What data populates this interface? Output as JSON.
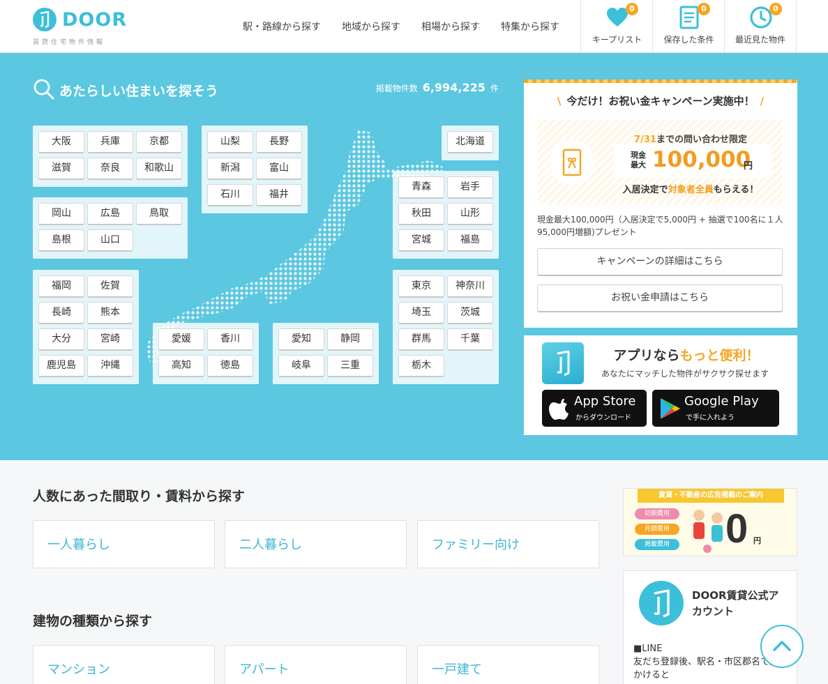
{
  "header": {
    "logo": {
      "text": "DOOR",
      "sub": "賃貸住宅物件情報"
    },
    "nav": [
      "駅・路線から探す",
      "地域から探す",
      "相場から探す",
      "特集から探す"
    ],
    "boxes": [
      {
        "label": "キープリスト",
        "badge": "0",
        "icon": "heart-icon"
      },
      {
        "label": "保存した条件",
        "badge": "0",
        "icon": "document-icon"
      },
      {
        "label": "最近見た物件",
        "badge": "0",
        "icon": "clock-icon"
      }
    ]
  },
  "hero": {
    "title": "あたらしい住まいを探そう",
    "count_label": "掲載物件数",
    "count_value": "6,994,225",
    "count_unit": "件",
    "regions": {
      "kinki": [
        "大阪",
        "兵庫",
        "京都",
        "滋賀",
        "奈良",
        "和歌山"
      ],
      "chugoku": [
        "岡山",
        "広島",
        "鳥取",
        "島根",
        "山口"
      ],
      "kyushu": [
        "福岡",
        "佐賀",
        "長崎",
        "熊本",
        "大分",
        "宮崎",
        "鹿児島",
        "沖縄"
      ],
      "hokuriku": [
        "山梨",
        "長野",
        "新潟",
        "富山",
        "石川",
        "福井"
      ],
      "shikoku": [
        "愛媛",
        "香川",
        "高知",
        "徳島"
      ],
      "tokai": [
        "愛知",
        "静岡",
        "岐阜",
        "三重"
      ],
      "hokkaido": [
        "北海道"
      ],
      "tohoku": [
        "青森",
        "岩手",
        "秋田",
        "山形",
        "宮城",
        "福島"
      ],
      "kanto": [
        "東京",
        "神奈川",
        "埼玉",
        "茨城",
        "群馬",
        "千葉",
        "栃木"
      ]
    }
  },
  "campaign": {
    "title": "今だけ！お祝い金キャンペーン実施中！",
    "limit_date": "7/31",
    "limit_text": "までの問い合わせ限定",
    "amount_label_1": "現金",
    "amount_label_2": "最大",
    "amount": "100,000",
    "amount_unit": "円",
    "cond_1": "入居決定で",
    "cond_2": "対象者全員",
    "cond_3": "もらえる！",
    "desc": "現金最大100,000円（入居決定で5,000円 + 抽選で100名に１人95,000円増額)プレゼント",
    "btn_detail": "キャンペーンの詳細はこちら",
    "btn_apply": "お祝い金申請はこちら"
  },
  "app": {
    "title_1": "アプリなら",
    "title_2": "もっと便利",
    "title_3": "！",
    "sub": "あなたにマッチした物件がサクサク探せます",
    "appstore_name": "App Store",
    "appstore_sub": "からダウンロード",
    "gplay_name": "Google Play",
    "gplay_sub": "で手に入れよう"
  },
  "sections": {
    "people_title": "人数にあった間取り・賃料から探す",
    "people": [
      "一人暮らし",
      "二人暮らし",
      "ファミリー向け"
    ],
    "building_title": "建物の種類から探す",
    "building": [
      "マンション",
      "アパート",
      "一戸建て"
    ]
  },
  "ad": {
    "banner": "賃貸・不動産の広告掲載のご案内",
    "tags": [
      "初期費用",
      "月額費用",
      "掲載費用"
    ],
    "zero": "0",
    "yen": "円"
  },
  "account": {
    "name": "DOOR賃貸公式アカウント",
    "line_head": "■LINE",
    "line_text": "友だち登録後、駅名・市区郡名で話しかけると"
  },
  "colors": {
    "brand": "#3cbfd8",
    "hero_bg": "#5bc7e0",
    "accent": "#f5a623"
  }
}
